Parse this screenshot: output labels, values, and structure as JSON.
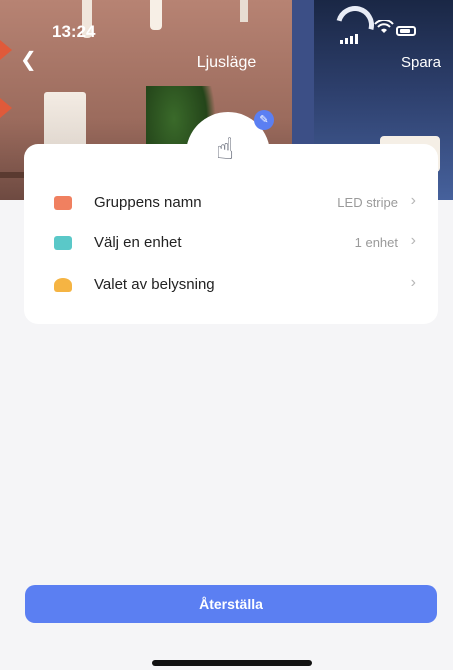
{
  "status_bar": {
    "time": "13:24"
  },
  "nav": {
    "back_icon": "chevron-left-icon",
    "title": "Ljusläge",
    "save_label": "Spara"
  },
  "group_icon": "touch-hand-icon",
  "rows": [
    {
      "label": "Gruppens namn",
      "value": "LED stripe",
      "icon": "message-icon",
      "icon_color": "#f08060"
    },
    {
      "label": "Välj en enhet",
      "value": "1 enhet",
      "icon": "devices-icon",
      "icon_color": "#5ac8c8"
    },
    {
      "label": "Valet av belysning",
      "value": "",
      "icon": "lamp-icon",
      "icon_color": "#f5b443"
    }
  ],
  "reset_label": "Återställa",
  "colors": {
    "accent": "#5b7ff2",
    "background": "#f5f5f7"
  }
}
